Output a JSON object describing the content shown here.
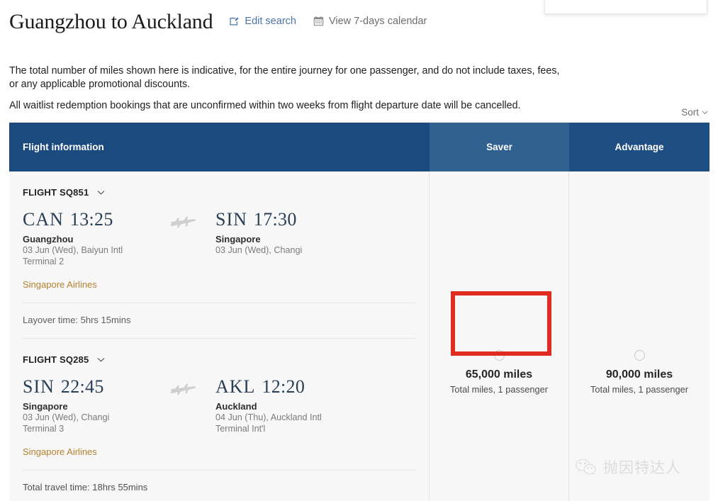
{
  "top_card": {
    "menu_dots": "•••"
  },
  "header": {
    "title": "Guangzhou to Auckland",
    "edit_search_label": "Edit search",
    "calendar_label": "View 7-days calendar"
  },
  "notice": {
    "line1": "The total number of miles shown here is indicative, for the entire journey for one passenger, and do not include taxes, fees, or any applicable promotional discounts.",
    "line2": "All waitlist redemption bookings that are unconfirmed within two weeks from flight departure date will be cancelled."
  },
  "sort": {
    "label": "Sort"
  },
  "table": {
    "columns": {
      "flight_information": "Flight information",
      "saver": "Saver",
      "advantage": "Advantage"
    },
    "segments": [
      {
        "flight_label": "FLIGHT SQ851",
        "depart": {
          "code": "CAN",
          "time": "13:25",
          "city": "Guangzhou",
          "date_airport": "03 Jun (Wed), Baiyun Intl",
          "terminal": "Terminal 2"
        },
        "arrive": {
          "code": "SIN",
          "time": "17:30",
          "city": "Singapore",
          "date_airport": "03 Jun (Wed), Changi",
          "terminal": ""
        },
        "airline": "Singapore Airlines"
      },
      {
        "flight_label": "FLIGHT SQ285",
        "depart": {
          "code": "SIN",
          "time": "22:45",
          "city": "Singapore",
          "date_airport": "03 Jun (Wed), Changi",
          "terminal": "Terminal 3"
        },
        "arrive": {
          "code": "AKL",
          "time": "12:20",
          "city": "Auckland",
          "date_airport": "04 Jun (Thu), Auckland Intl",
          "terminal": "Terminal Int'l"
        },
        "airline": "Singapore Airlines"
      }
    ],
    "layover": "Layover time: 5hrs 15mins",
    "total_travel_time": "Total travel time: 18hrs 55mins",
    "fares": [
      {
        "cabin": "Saver",
        "miles": "65,000 miles",
        "sub": "Total miles, 1 passenger",
        "selected": false,
        "highlighted": true
      },
      {
        "cabin": "Advantage",
        "miles": "90,000 miles",
        "sub": "Total miles, 1 passenger",
        "selected": false,
        "highlighted": false
      }
    ]
  },
  "watermark": {
    "text": "抛因特达人"
  },
  "colors": {
    "header_primary": "#1b4a7e",
    "header_saver": "#31618f",
    "header_advantage": "#1f4e82",
    "highlight_red": "#e02b20",
    "airline_gold": "#b5802f",
    "link_blue": "#4a73a8",
    "body_bg": "#f7f7f7"
  }
}
